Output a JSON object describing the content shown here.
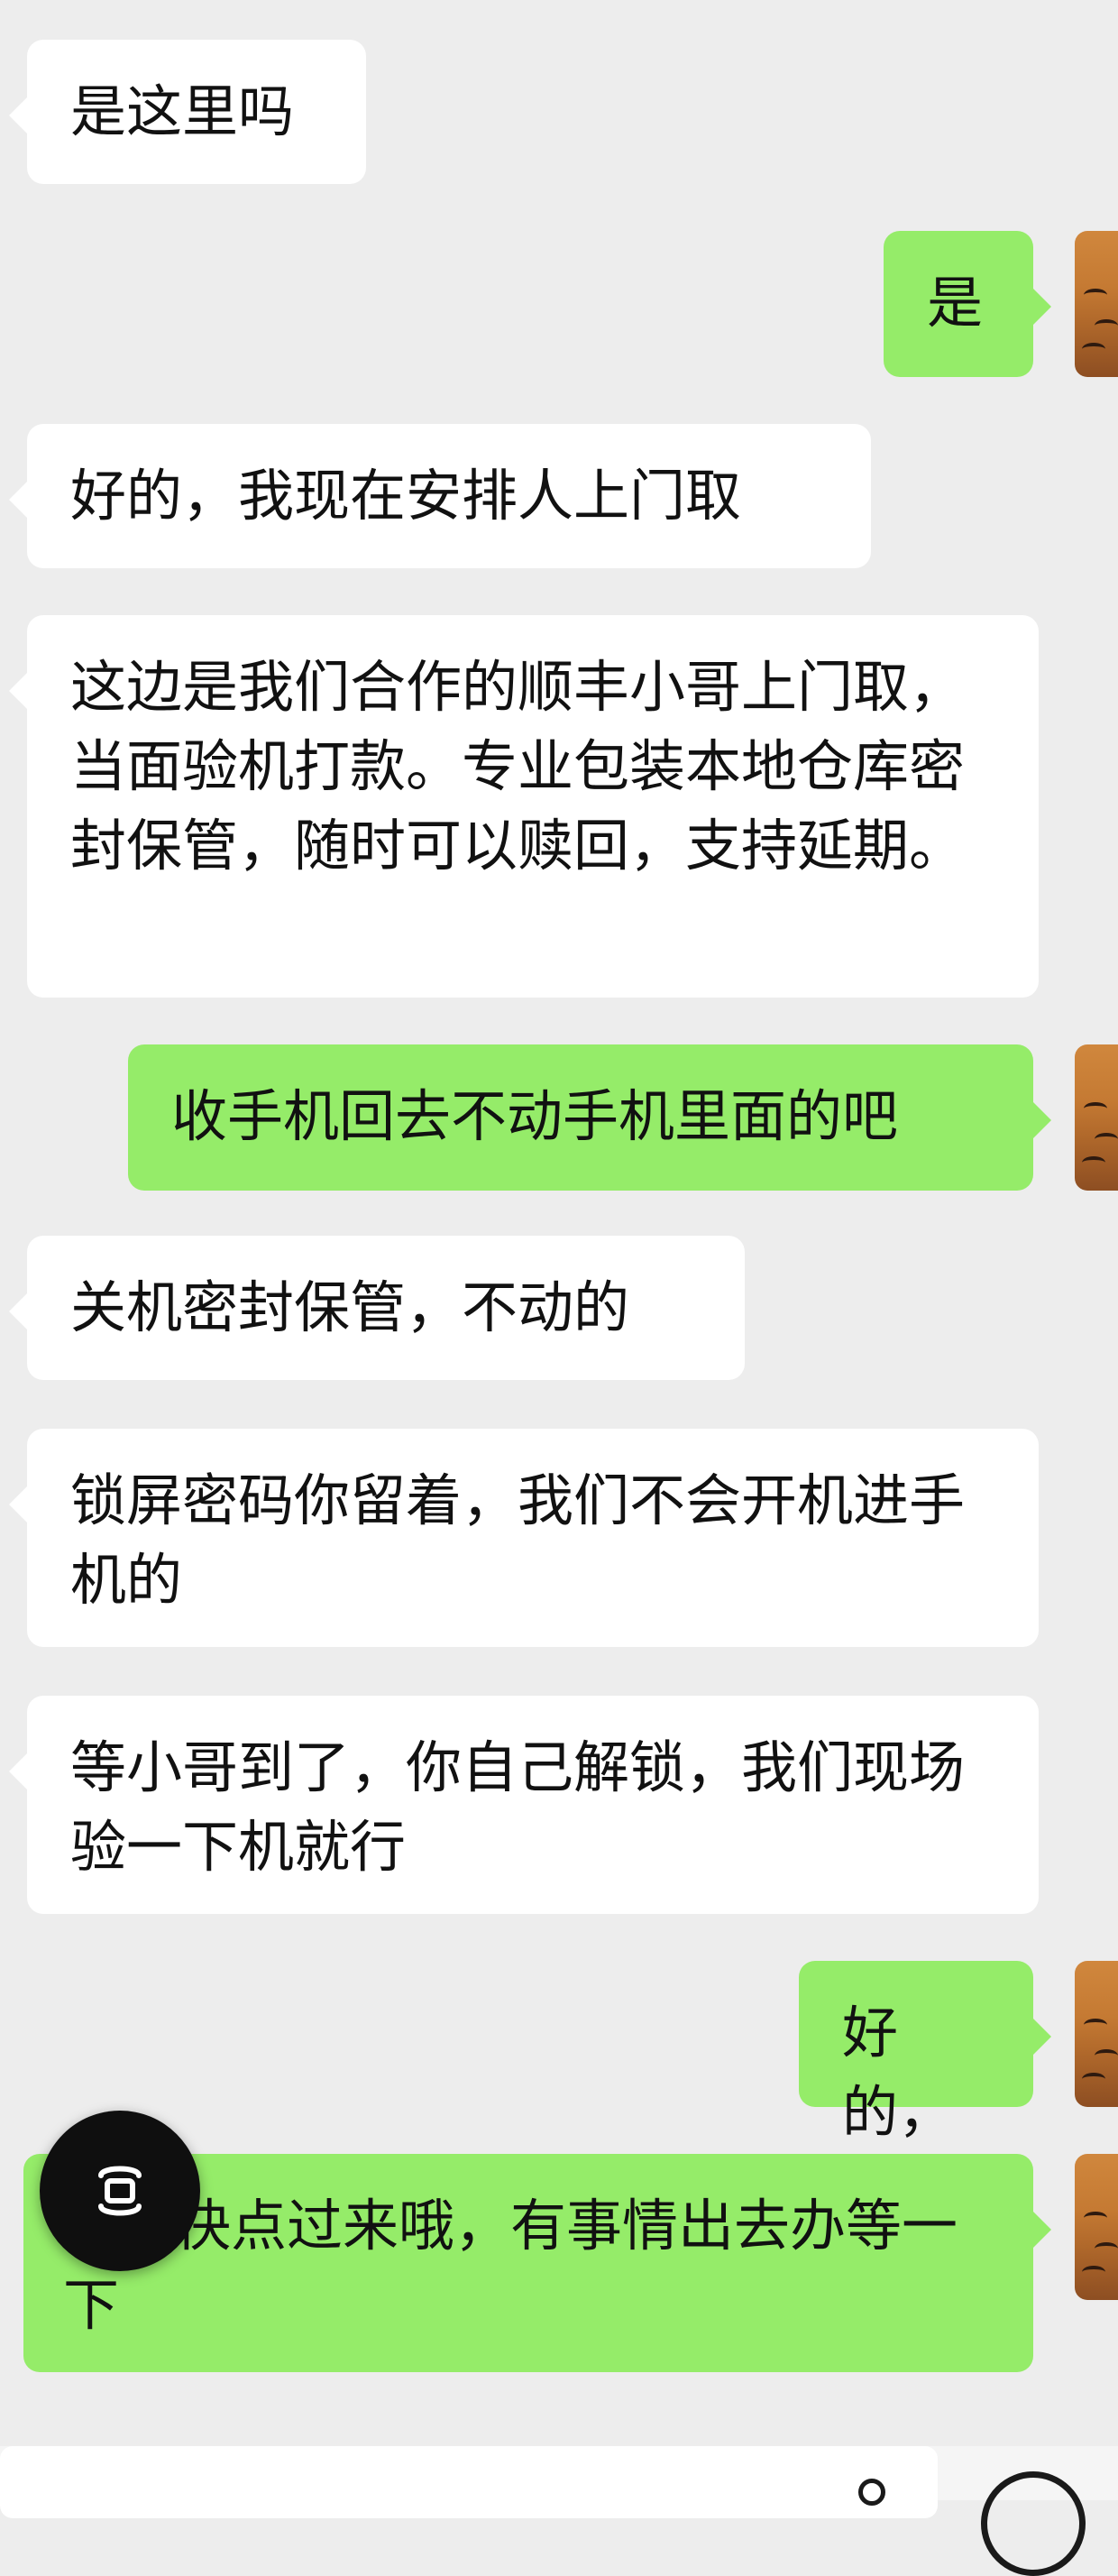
{
  "messages": [
    {
      "side": "left",
      "text": "是这里吗"
    },
    {
      "side": "right",
      "text": "是"
    },
    {
      "side": "left",
      "text": "好的，我现在安排人上门取"
    },
    {
      "side": "left",
      "text": "这边是我们合作的顺丰小哥上门取，当面验机打款。专业包装本地仓库密封保管，随时可以赎回，支持延期。"
    },
    {
      "side": "right",
      "text": "收手机回去不动手机里面的吧"
    },
    {
      "side": "left",
      "text": "关机密封保管，不动的"
    },
    {
      "side": "left",
      "text": "锁屏密码你留着，我们不会开机进手机的"
    },
    {
      "side": "left",
      "text": "等小哥到了，你自己解锁，我们现场验一下机就行"
    },
    {
      "side": "right",
      "text": "好的，"
    },
    {
      "side": "right",
      "text": "尽量快点过来哦，有事情出去办等一下"
    }
  ],
  "colors": {
    "background": "#ededed",
    "incoming_bubble": "#ffffff",
    "outgoing_bubble": "#95ec69"
  },
  "icons": {
    "floating": "screen-capture-icon",
    "emoji": "emoji-icon",
    "voice": "voice-icon"
  }
}
